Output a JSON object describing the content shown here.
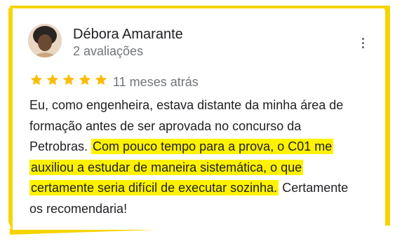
{
  "review": {
    "author_name": "Débora Amarante",
    "author_review_count": "2 avaliações",
    "rating": 5,
    "max_rating": 5,
    "time_ago": "11 meses atrás",
    "text_lines": {
      "l1": "Eu, como engenheira, estava distante da minha área de",
      "l2": "formação antes de ser aprovada no concurso da",
      "l3_plain": "Petrobras. ",
      "l3_hl": "Com pouco tempo para a prova, o C01 me",
      "l4_hl": "auxiliou a estudar de maneira sistemática, o que",
      "l5_hl": "certamente seria difícil de executar sozinha.",
      "l5_plain": " Certamente",
      "l6": "os recomendaria!"
    }
  },
  "icons": {
    "star": "star-icon",
    "menu": "more-vertical-icon",
    "avatar": "user-avatar"
  },
  "colors": {
    "frame_accent": "#f5d400",
    "highlight": "#fff200",
    "star": "#fbbc04",
    "text": "#202124",
    "secondary_text": "#70757a"
  }
}
